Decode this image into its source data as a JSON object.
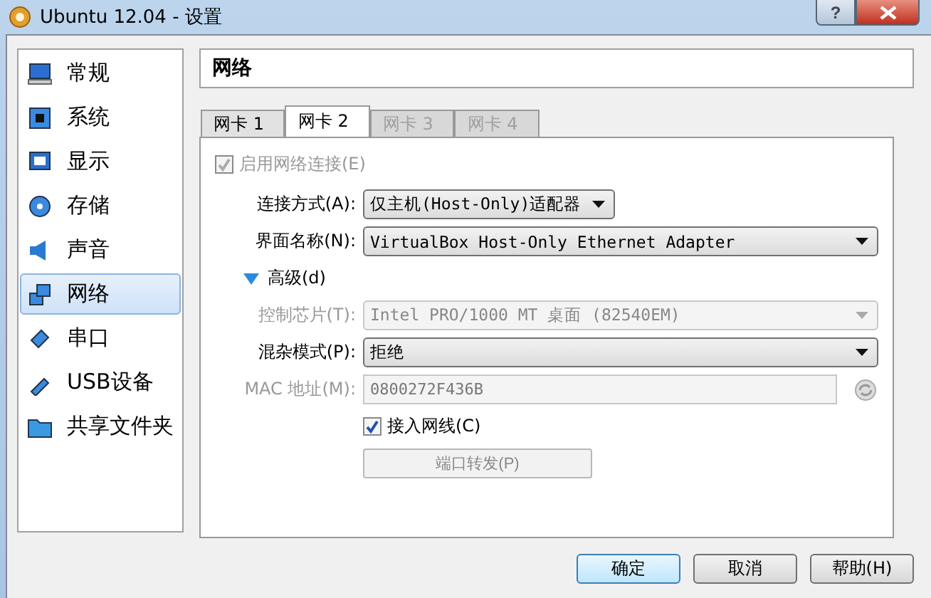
{
  "window": {
    "title": "Ubuntu 12.04 - 设置",
    "help": "?"
  },
  "sidebar": {
    "items": [
      {
        "label": "常规",
        "selected": false
      },
      {
        "label": "系统",
        "selected": false
      },
      {
        "label": "显示",
        "selected": false
      },
      {
        "label": "存储",
        "selected": false
      },
      {
        "label": "声音",
        "selected": false
      },
      {
        "label": "网络",
        "selected": true
      },
      {
        "label": "串口",
        "selected": false
      },
      {
        "label": "USB设备",
        "selected": false
      },
      {
        "label": "共享文件夹",
        "selected": false
      }
    ]
  },
  "page_title": "网络",
  "tabs": [
    {
      "label": "网卡 1",
      "selected": false,
      "disabled": false
    },
    {
      "label": "网卡 2",
      "selected": true,
      "disabled": false
    },
    {
      "label": "网卡 3",
      "selected": false,
      "disabled": true
    },
    {
      "label": "网卡 4",
      "selected": false,
      "disabled": true
    }
  ],
  "form": [
    {
      "kind": "checkbox",
      "label": "启用网络连接(E)",
      "checked": true,
      "disabled": true
    },
    {
      "kind": "select",
      "label": "连接方式(A):",
      "value": "仅主机(Host-Only)适配器",
      "disabled": false,
      "wide": false
    },
    {
      "kind": "select",
      "label": "界面名称(N):",
      "value": "VirtualBox Host-Only Ethernet Adapter",
      "disabled": false,
      "wide": true
    },
    {
      "kind": "expander",
      "label": "高级(d)",
      "expanded": true
    },
    {
      "kind": "select",
      "label": "控制芯片(T):",
      "value": "Intel PRO/1000 MT 桌面 (82540EM)",
      "disabled": true,
      "wide": true
    },
    {
      "kind": "select",
      "label": "混杂模式(P):",
      "value": "拒绝",
      "disabled": false,
      "wide": true
    },
    {
      "kind": "text",
      "label": "MAC 地址(M):",
      "value": "0800272F436B",
      "disabled": true
    },
    {
      "kind": "checkbox",
      "label": "接入网线(C)",
      "checked": true,
      "disabled": false
    },
    {
      "kind": "button",
      "label": "端口转发(P)",
      "disabled": true
    }
  ],
  "buttons": [
    {
      "label": "确定",
      "default": true
    },
    {
      "label": "取消",
      "default": false
    },
    {
      "label": "帮助(H)",
      "default": false
    }
  ]
}
